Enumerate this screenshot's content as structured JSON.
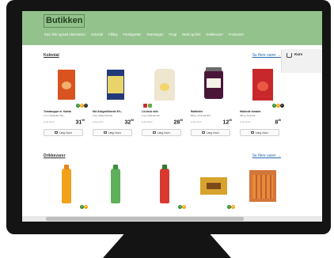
{
  "site": {
    "logo": "Butikken",
    "nav": [
      "Kød, fisk og kød alternativer",
      "Kolonial",
      "Fålleg",
      "Færdigretter",
      "Drømsager",
      "Frugt",
      "Brød og kiks",
      "Drikkevarer",
      "Frostvarer"
    ]
  },
  "cart": {
    "label": "Kurv",
    "icon": "shopping-bag-icon"
  },
  "sections": [
    {
      "title": "Kolonial",
      "see_more": "Se flere varer →",
      "products": [
        {
          "art": "soup",
          "name": "Tomatsuppe m. Kødsk",
          "sub": "1 ltr. / Kødboller Mrk.",
          "unit": "kr./kg 30,00",
          "price": "31",
          "price_sup": "95",
          "badges": [
            "A",
            "B",
            "C"
          ]
        },
        {
          "art": "box-blue",
          "name": "Mel Alsiged/bloede 8%...",
          "sub": "1 kg / Dalig Kolonial",
          "unit": "kr./kg 32,00",
          "price": "32",
          "price_sup": "95",
          "badges": []
        },
        {
          "art": "pouch",
          "name": "Lin-bruk skin",
          "sub": "1 kg / Kolonial skin",
          "unit": "kr./kg 28,00",
          "price": "28",
          "price_sup": "95",
          "badges": [],
          "eco": true
        },
        {
          "art": "jar",
          "name": "Rødbeder",
          "sub": "500 g / Kolonial Mrk.",
          "unit": "kr./kg 24,00",
          "price": "12",
          "price_sup": "95",
          "badges": []
        },
        {
          "art": "carton",
          "name": "Hakkede tomater",
          "sub": "390 g / Kolonial",
          "unit": "kr./kg 20,00",
          "price": "8",
          "price_sup": "95",
          "badges": [
            "A",
            "B",
            "C"
          ]
        }
      ],
      "button_label": "Læg i kurv"
    },
    {
      "title": "Drikkevarer",
      "see_more": "Se flere varer →",
      "products": [
        {
          "art": "bottle-orange",
          "badges": [
            "A",
            "B"
          ]
        },
        {
          "art": "bottle-green",
          "badges": []
        },
        {
          "art": "bottle-red",
          "badges": [
            "A",
            "B"
          ]
        },
        {
          "art": "pack-yellow",
          "badges": [
            "A",
            "B"
          ]
        },
        {
          "art": "crate",
          "badges": []
        }
      ]
    }
  ],
  "colors": {
    "header": "#94c28d",
    "accent": "#2b6cb0"
  }
}
